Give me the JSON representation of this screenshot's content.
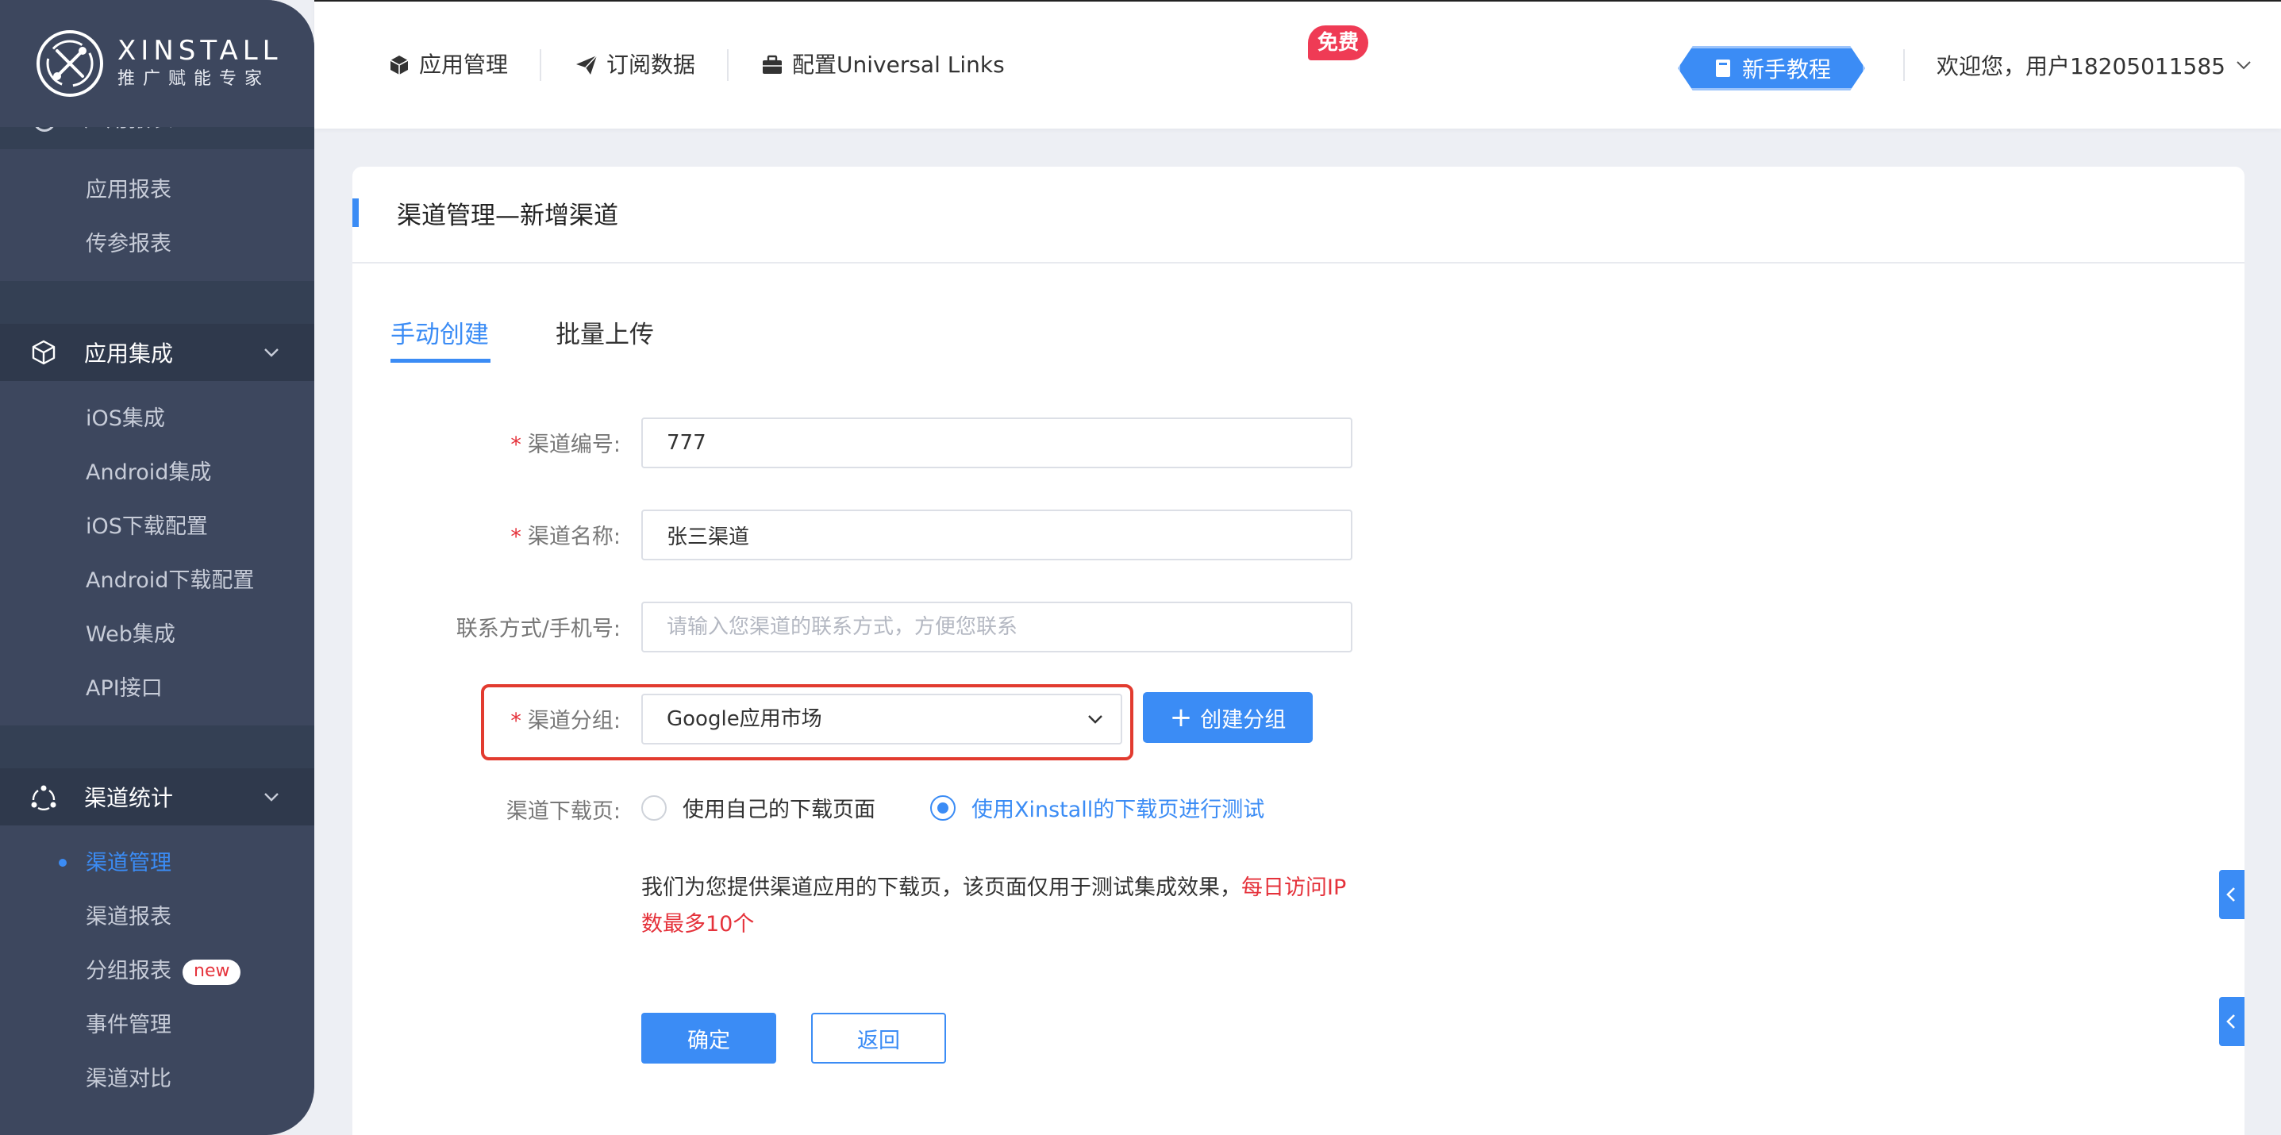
{
  "logo": {
    "title": "XINSTALL",
    "subtitle": "推广赋能专家"
  },
  "sidebar": {
    "cut_header": "应用报表",
    "report_items": [
      "应用报表",
      "传参报表"
    ],
    "group_integration": {
      "label": "应用集成",
      "items": [
        "iOS集成",
        "Android集成",
        "iOS下载配置",
        "Android下载配置",
        "Web集成",
        "API接口"
      ]
    },
    "group_channel": {
      "label": "渠道统计",
      "items": [
        "渠道管理",
        "渠道报表",
        "分组报表",
        "事件管理",
        "渠道对比"
      ],
      "active": "渠道管理",
      "badge": "new"
    }
  },
  "topbar": {
    "nav": [
      "应用管理",
      "订阅数据",
      "配置Universal Links"
    ],
    "free_badge": "免费",
    "tutorial": "新手教程",
    "welcome": "欢迎您，用户18205011585"
  },
  "card": {
    "title": "渠道管理—新增渠道",
    "tabs": [
      "手动创建",
      "批量上传"
    ],
    "form": {
      "channel_code_label": "渠道编号:",
      "channel_code_value": "777",
      "channel_name_label": "渠道名称:",
      "channel_name_value": "张三渠道",
      "contact_label": "联系方式/手机号:",
      "contact_placeholder": "请输入您渠道的联系方式，方便您联系",
      "group_label": "渠道分组:",
      "group_value": "Google应用市场",
      "create_group": "创建分组",
      "download_label": "渠道下载页:",
      "radio_own": "使用自己的下载页面",
      "radio_xinstall": "使用Xinstall的下载页进行测试",
      "note_main": "我们为您提供渠道应用的下载页，该页面仅用于测试集成效果，",
      "note_warn": "每日访问IP数最多10个",
      "confirm": "确定",
      "back": "返回"
    }
  },
  "colors": {
    "accent": "#3b8cf5",
    "sidebar": "#3d475e",
    "danger": "#e5323b"
  }
}
